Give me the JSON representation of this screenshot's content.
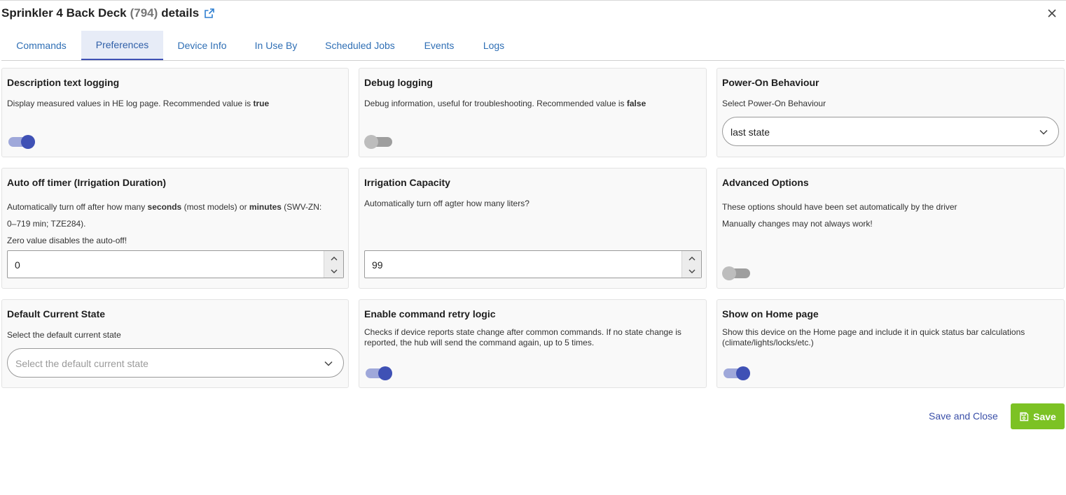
{
  "header": {
    "device_name": "Sprinkler 4 Back Deck",
    "device_id": "(794)",
    "title_suffix": "details"
  },
  "tabs": [
    {
      "label": "Commands",
      "active": false
    },
    {
      "label": "Preferences",
      "active": true
    },
    {
      "label": "Device Info",
      "active": false
    },
    {
      "label": "In Use By",
      "active": false
    },
    {
      "label": "Scheduled Jobs",
      "active": false
    },
    {
      "label": "Events",
      "active": false
    },
    {
      "label": "Logs",
      "active": false
    }
  ],
  "prefs": {
    "description_logging": {
      "title": "Description text logging",
      "desc_text": "Display measured values in HE log page. Recommended value is ",
      "desc_bold": "true",
      "enabled": true
    },
    "debug_logging": {
      "title": "Debug logging",
      "desc_text": "Debug information, useful for troubleshooting. Recommended value is ",
      "desc_bold": "false",
      "enabled": false
    },
    "power_on": {
      "title": "Power-On Behaviour",
      "desc": "Select Power-On Behaviour",
      "value": "last state"
    },
    "auto_off": {
      "title": "Auto off timer (Irrigation Duration)",
      "desc_p1": "Automatically turn off after how many ",
      "desc_b1": "seconds",
      "desc_p2": " (most models) or ",
      "desc_b2": "minutes",
      "desc_p3": " (SWV-ZN:",
      "desc_line2": "0–719 min; TZE284).",
      "desc_line3": "Zero value disables the auto-off!",
      "value": "0"
    },
    "capacity": {
      "title": "Irrigation Capacity",
      "desc": "Automatically turn off agter how many liters?",
      "value": "99"
    },
    "advanced": {
      "title": "Advanced Options",
      "desc_line1": "These options should have been set automatically by the driver",
      "desc_line2": "Manually changes may not always work!",
      "enabled": false
    },
    "default_state": {
      "title": "Default Current State",
      "desc": "Select the default current state",
      "placeholder": "Select the default current state"
    },
    "retry": {
      "title": "Enable command retry logic",
      "desc": "Checks if device reports state change after common commands. If no state change is reported, the hub will send the command again, up to 5 times.",
      "enabled": true
    },
    "home_page": {
      "title": "Show on Home page",
      "desc": "Show this device on the Home page and include it in quick status bar calculations (climate/lights/locks/etc.)",
      "enabled": true
    }
  },
  "footer": {
    "save_close_label": "Save and Close",
    "save_label": "Save"
  },
  "colors": {
    "accent": "#3f51b5",
    "toggle_track_on": "#9fa8da",
    "save_button": "#7cc224",
    "link": "#2f6fb5"
  },
  "icons": {
    "external": "external-link-icon",
    "close": "close-icon",
    "chevron": "chevron-down-icon",
    "save": "floppy-disk-icon"
  }
}
